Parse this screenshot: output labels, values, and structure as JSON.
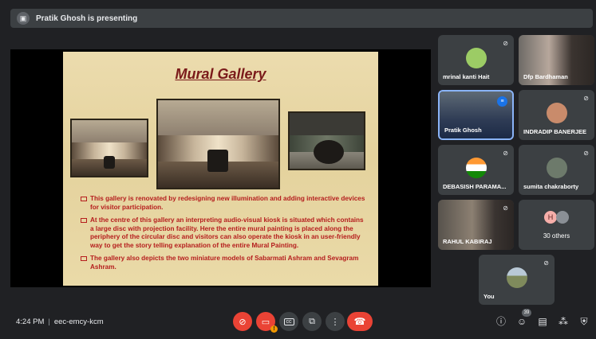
{
  "presenter": {
    "icon": "presentation-icon",
    "text": "Pratik Ghosh is presenting"
  },
  "slide": {
    "title": "Mural Gallery",
    "bullets": [
      "This gallery is renovated by redesigning new illumination and adding interactive devices for visitor participation.",
      "At the centre of this gallery an interpreting audio-visual kiosk is situated which contains a large disc with projection facility. Here the entire mural painting is placed along the periphery of the circular disc and visitors can also operate the kiosk in an user-friendly way to get the story telling explanation of the entire Mural Painting.",
      "The gallery also depicts the two miniature models of Sabarmati Ashram and Sevagram Ashram."
    ]
  },
  "participants": [
    {
      "name": "mrinal kanti Hait",
      "muted": true
    },
    {
      "name": "Dfp Bardhaman",
      "muted": false
    },
    {
      "name": "Pratik Ghosh",
      "muted": false,
      "speaking": true
    },
    {
      "name": "INDRADIP BANERJEE",
      "muted": true
    },
    {
      "name": "DEBASISH PARAMA...",
      "muted": true
    },
    {
      "name": "sumita chakraborty",
      "muted": true
    },
    {
      "name": "RAHUL KABIRAJ",
      "muted": true
    },
    {
      "name": "30 others",
      "muted": false,
      "avatar_letter": "H"
    },
    {
      "name": "You",
      "muted": true
    }
  ],
  "meeting": {
    "time": "4:24 PM",
    "code": "eec-emcy-kcm",
    "people_count": "39"
  },
  "colors": {
    "end_call": "#ea4335",
    "background": "#202124",
    "tile": "#3c4043",
    "slide_text": "#b51d1d"
  }
}
